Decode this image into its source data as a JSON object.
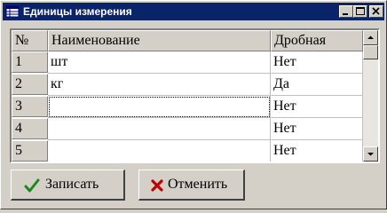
{
  "window": {
    "title": "Единицы измерения",
    "icon": "app-grid-icon",
    "title_bar_color": "#0a246a"
  },
  "caption_buttons": [
    "minimize-icon",
    "maximize-icon",
    "close-icon"
  ],
  "grid": {
    "columns": [
      "№",
      "Наименование",
      "Дробная"
    ],
    "rows": [
      {
        "num": "1",
        "name": "шт",
        "fractional": "Нет"
      },
      {
        "num": "2",
        "name": "кг",
        "fractional": "Да"
      },
      {
        "num": "3",
        "name": "",
        "fractional": "Нет"
      },
      {
        "num": "4",
        "name": "",
        "fractional": "Нет"
      },
      {
        "num": "5",
        "name": "",
        "fractional": "Нет"
      }
    ]
  },
  "buttons": {
    "save_label": "Записать",
    "save_icon": "green-check-icon",
    "cancel_label": "Отменить",
    "cancel_icon": "red-x-icon"
  },
  "colors": {
    "check": "#1a8a1a",
    "cancel_x": "#c00000"
  }
}
